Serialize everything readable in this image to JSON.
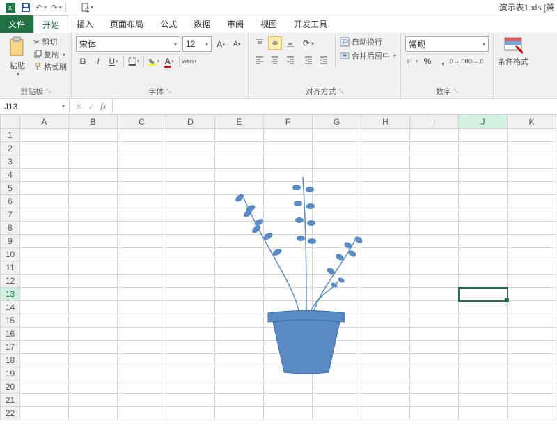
{
  "titlebar": {
    "doc_title": "演示表1.xls  [兼"
  },
  "tabs": {
    "file": "文件",
    "items": [
      "开始",
      "插入",
      "页面布局",
      "公式",
      "数据",
      "审阅",
      "视图",
      "开发工具"
    ],
    "active_index": 0
  },
  "ribbon": {
    "clipboard": {
      "paste": "粘贴",
      "cut": "剪切",
      "copy": "复制",
      "format_painter": "格式刷",
      "label": "剪贴板"
    },
    "font": {
      "name": "宋体",
      "size": "12",
      "label": "字体",
      "wen": "wén"
    },
    "alignment": {
      "wrap": "自动换行",
      "merge": "合并后居中",
      "label": "对齐方式"
    },
    "number": {
      "format": "常规",
      "label": "数字"
    },
    "styles": {
      "cond_format": "条件格式"
    }
  },
  "namebox": {
    "ref": "J13"
  },
  "grid": {
    "columns": [
      "A",
      "B",
      "C",
      "D",
      "E",
      "F",
      "G",
      "H",
      "I",
      "J",
      "K"
    ],
    "row_count": 22,
    "active_col": "J",
    "active_row": 13
  }
}
